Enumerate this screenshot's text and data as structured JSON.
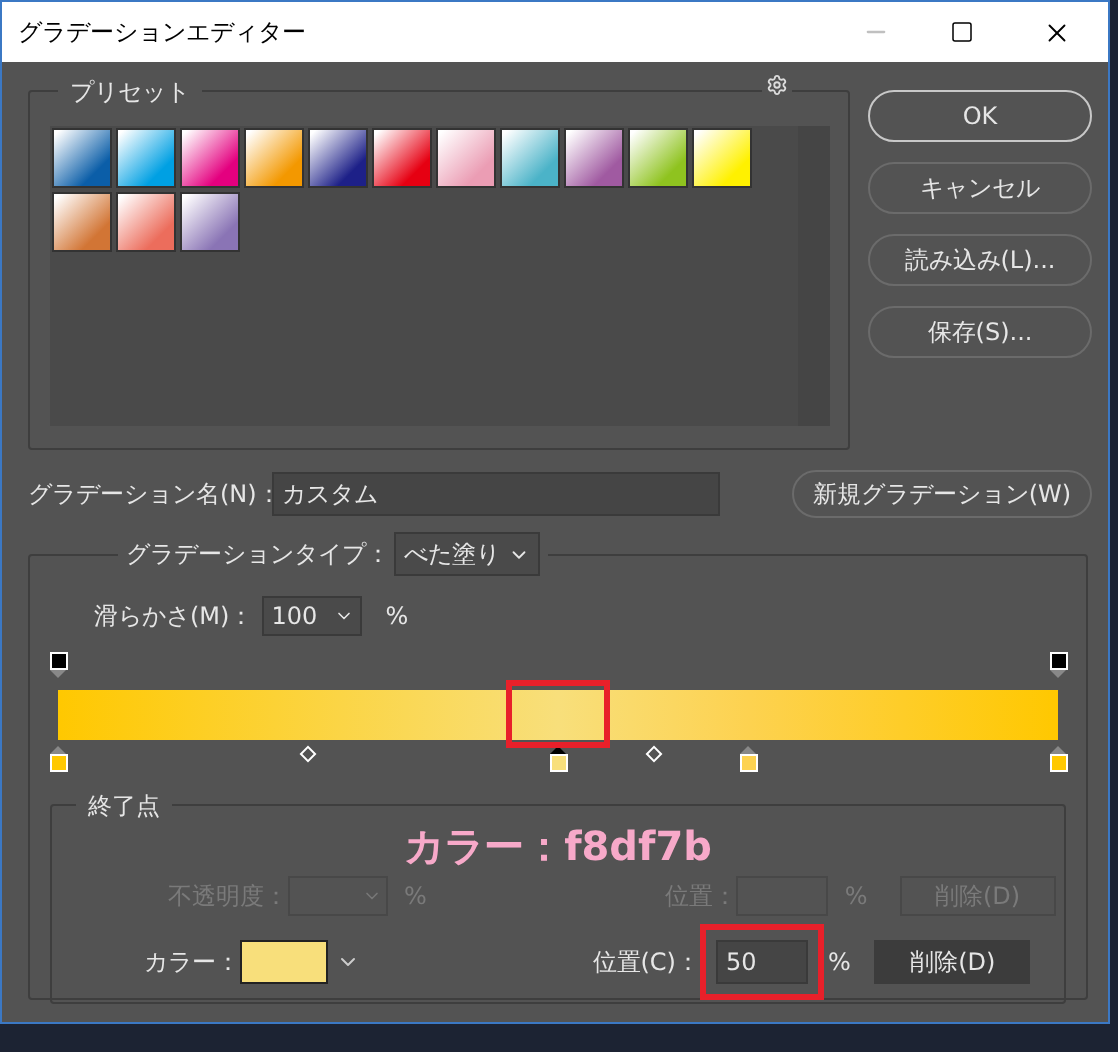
{
  "window": {
    "title": "グラデーションエディター"
  },
  "presets": {
    "label": "プリセット",
    "items": [
      {
        "color": "#0b5ea8"
      },
      {
        "color": "#00a0e3"
      },
      {
        "color": "#e4007f"
      },
      {
        "color": "#f39800"
      },
      {
        "color": "#1d2088"
      },
      {
        "color": "#e60012"
      },
      {
        "color": "#eb9db4"
      },
      {
        "color": "#4bb3c8"
      },
      {
        "color": "#a05aa1"
      },
      {
        "color": "#8fc31f"
      },
      {
        "color": "#fff100"
      },
      {
        "color": "#d27535"
      },
      {
        "color": "#ec6d5c"
      },
      {
        "color": "#8a74b5"
      }
    ]
  },
  "buttons": [
    {
      "label": "OK",
      "default": true
    },
    {
      "label": "キャンセル",
      "default": false
    },
    {
      "label": "読み込み(L)...",
      "default": false
    },
    {
      "label": "保存(S)...",
      "default": false
    }
  ],
  "name_field": {
    "label": "グラデーション名(N)：",
    "value": "カスタム"
  },
  "new_button": {
    "label": "新規グラデーション(W)"
  },
  "gradient_type": {
    "label": "グラデーションタイプ：",
    "value": "べた塗り"
  },
  "smoothness": {
    "label": "滑らかさ(M)：",
    "value": "100",
    "unit": "%"
  },
  "opacity_stops": [
    {
      "color": "#000000"
    },
    {
      "color": "#000000"
    }
  ],
  "color_stops": [
    {
      "color": "#ffc800",
      "selected": false
    },
    {
      "color": "#f8df7b",
      "selected": true
    },
    {
      "color": "#fdd250",
      "selected": false
    },
    {
      "color": "#ffc800",
      "selected": false
    }
  ],
  "selected_stop_highlighted": true,
  "stops_section": {
    "title": "終了点",
    "opacity_row": {
      "label": "不透明度：",
      "unit": "%",
      "position_label": "位置：",
      "position_unit": "%",
      "delete": "削除(D)",
      "disabled": true
    },
    "color_row": {
      "label": "カラー：",
      "color": "#f8df7b",
      "position_label": "位置(C)：",
      "position_value": "50",
      "position_unit": "%",
      "delete": "削除(D)",
      "disabled": false,
      "highlighted": true
    }
  },
  "annotation": {
    "text": "カラー：f8df7b"
  }
}
